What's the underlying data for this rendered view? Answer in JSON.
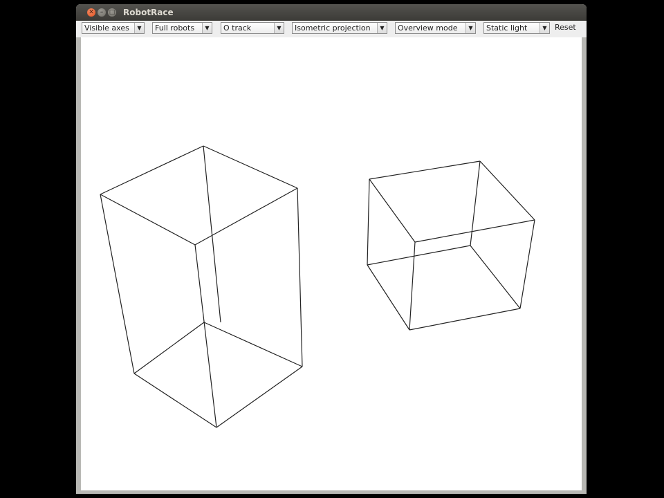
{
  "window": {
    "title": "RobotRace"
  },
  "toolbar": {
    "axes_select": "Visible axes",
    "robots_select": "Full robots",
    "track_select": "O track",
    "projection_select": "Isometric projection",
    "mode_select": "Overview mode",
    "light_select": "Static light",
    "reset_label": "Reset"
  },
  "scene": {
    "objects": [
      "wireframe-box",
      "wireframe-box"
    ]
  },
  "colors": {
    "titlebar": "#3c3b37",
    "close_button": "#e2501e",
    "canvas": "#ffffff",
    "wireframe": "#222222"
  }
}
